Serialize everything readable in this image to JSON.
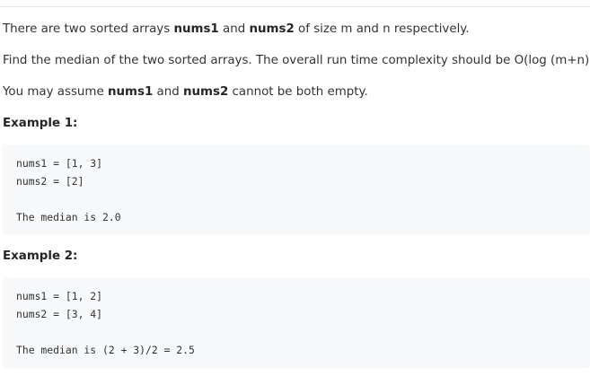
{
  "intro": {
    "p1_pre": "There are two sorted arrays ",
    "p1_b1": "nums1",
    "p1_mid": " and ",
    "p1_b2": "nums2",
    "p1_post": " of size m and n respectively.",
    "p2": "Find the median of the two sorted arrays. The overall run time complexity should be O(log (m+n)).",
    "p3_pre": "You may assume ",
    "p3_b1": "nums1",
    "p3_mid": " and ",
    "p3_b2": "nums2",
    "p3_post": " cannot be both empty."
  },
  "examples": [
    {
      "heading": "Example 1:",
      "line1": "nums1 = [1, 3]",
      "line2": "nums2 = [2]",
      "result": "The median is 2.0"
    },
    {
      "heading": "Example 2:",
      "line1": "nums1 = [1, 2]",
      "line2": "nums2 = [3, 4]",
      "result": "The median is (2 + 3)/2 = 2.5"
    }
  ]
}
